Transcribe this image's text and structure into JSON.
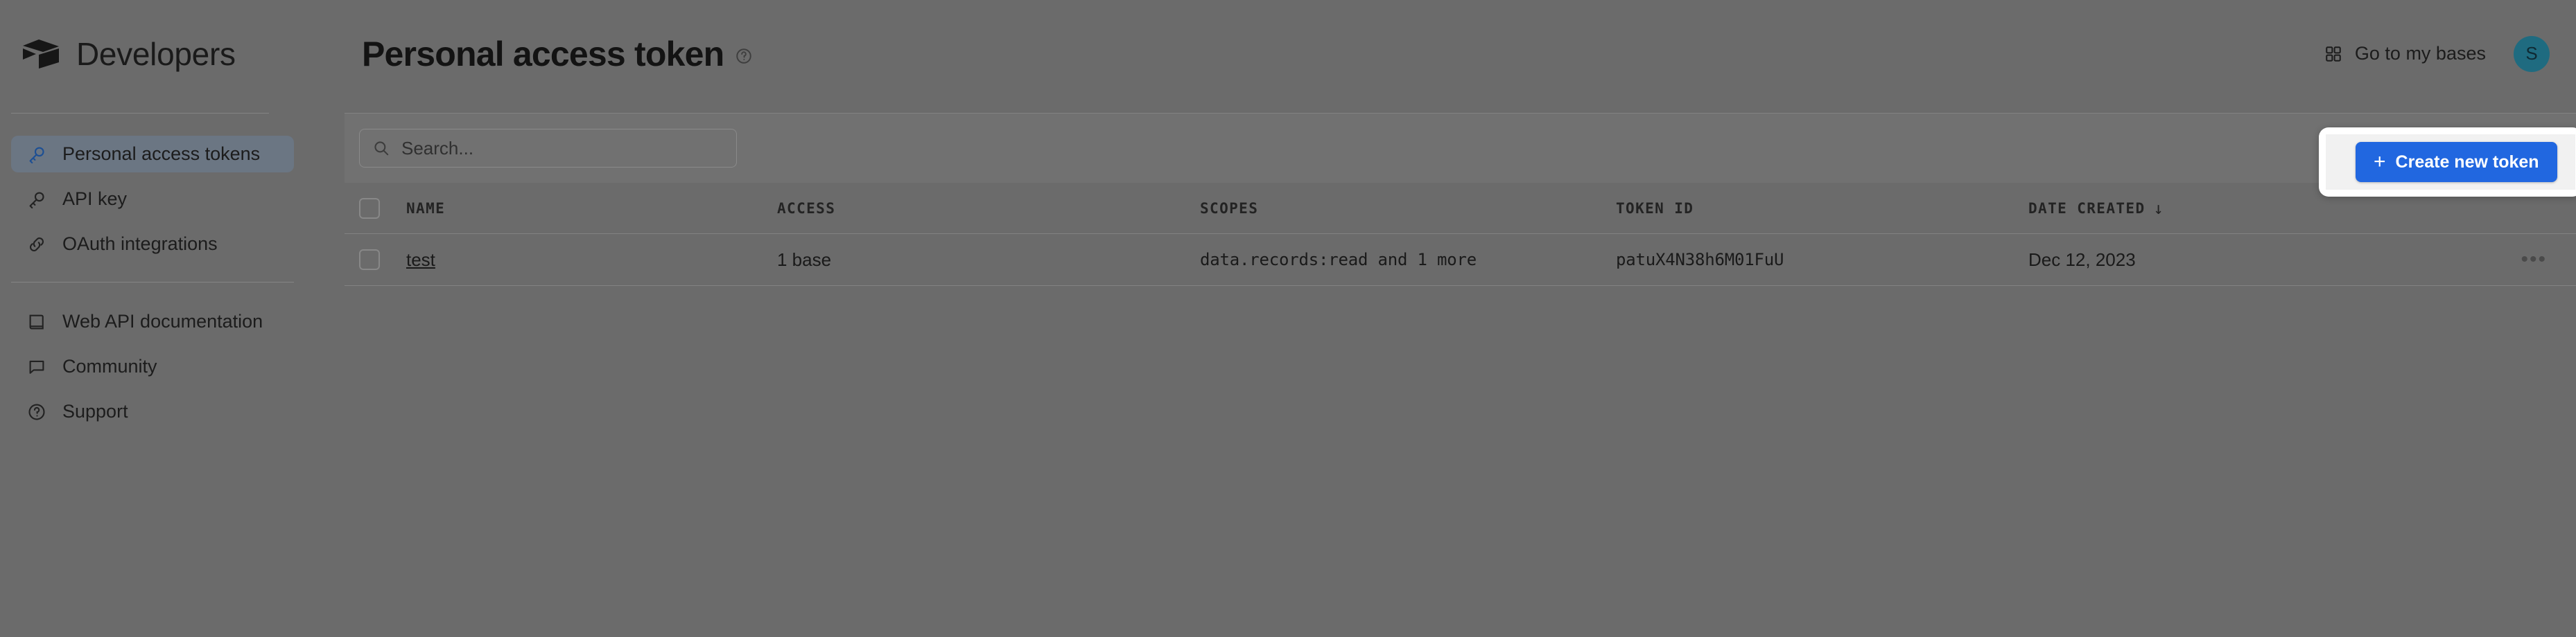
{
  "header": {
    "brand": "Developers",
    "brand_logo_icon": "cube-logo-icon",
    "page_title": "Personal access token",
    "title_help_icon": "help-circle-icon",
    "bases_link": "Go to my bases",
    "bases_icon": "grid-icon",
    "avatar_initial": "S",
    "avatar_color": "#1f6b80"
  },
  "sidebar": {
    "items": [
      {
        "label": "Personal access tokens",
        "icon": "key-icon",
        "active": true
      },
      {
        "label": "API key",
        "icon": "key-icon",
        "active": false
      },
      {
        "label": "OAuth integrations",
        "icon": "link-chain-icon",
        "active": false
      }
    ],
    "secondary_items": [
      {
        "label": "Web API documentation",
        "icon": "book-icon"
      },
      {
        "label": "Community",
        "icon": "chat-bubble-icon"
      },
      {
        "label": "Support",
        "icon": "question-circle-icon"
      }
    ]
  },
  "toolbar": {
    "search_placeholder": "Search...",
    "search_value": "",
    "search_icon": "search-icon",
    "create_button_label": "Create new token",
    "create_button_plus": "+",
    "create_button_color": "#2167e0"
  },
  "table": {
    "columns": [
      {
        "key": "name",
        "label": "NAME"
      },
      {
        "key": "access",
        "label": "ACCESS"
      },
      {
        "key": "scopes",
        "label": "SCOPES"
      },
      {
        "key": "token",
        "label": "TOKEN ID"
      },
      {
        "key": "date",
        "label": "DATE CREATED"
      }
    ],
    "sort_indicator": "↓",
    "rows": [
      {
        "name": "test",
        "access": "1 base",
        "scopes": "data.records:read and 1 more",
        "token": "patuX4N38h6M01FuU",
        "date": "Dec 12, 2023",
        "menu": "•••"
      }
    ]
  }
}
